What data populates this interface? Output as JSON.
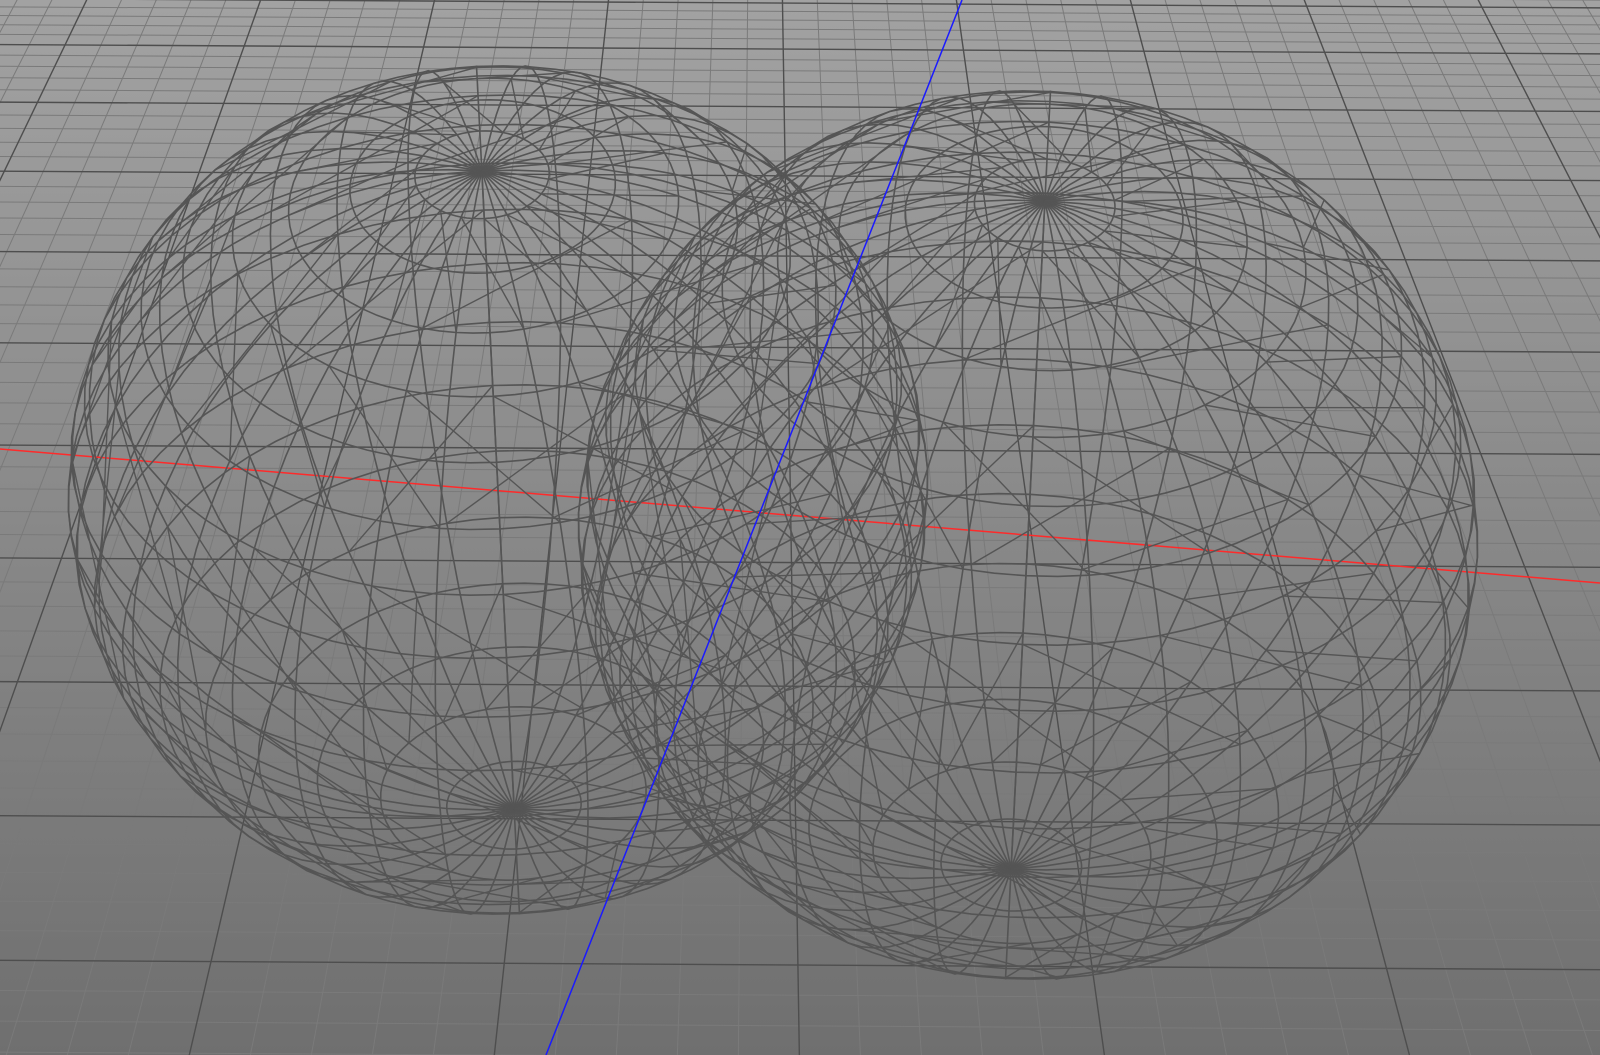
{
  "viewport": {
    "view": "perspective",
    "display_mode": "wireframe",
    "grid_visible": true,
    "background_colors": {
      "top": "#a2a2a2",
      "bottom": "#6f6f6f"
    }
  },
  "colors": {
    "grid_minor": "#7a7a7a",
    "grid_major": "#4e4e4e",
    "x_axis": "#ff2a2a",
    "y_axis": "#1a1aff",
    "wireframe": "#555555"
  },
  "objects": [
    {
      "name": "sphere-left",
      "type": "polySphere",
      "subdivisions_axis": 36,
      "subdivisions_height": 20,
      "selected": false
    },
    {
      "name": "sphere-right",
      "type": "polySphere",
      "subdivisions_axis": 36,
      "subdivisions_height": 20,
      "selected": false
    }
  ]
}
